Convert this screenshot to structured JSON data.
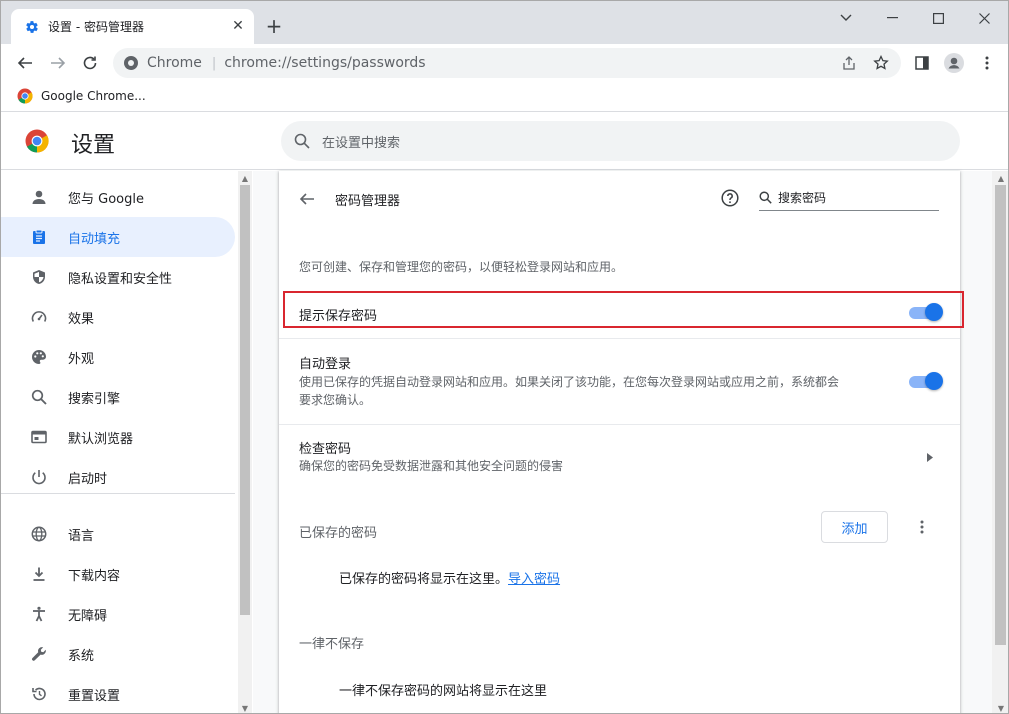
{
  "browser": {
    "tab_title": "设置 - 密码管理器",
    "site_label": "Chrome",
    "url": "chrome://settings/passwords",
    "bookmark_label": "Google Chrome..."
  },
  "settings": {
    "heading": "设置",
    "search_placeholder": "在设置中搜索"
  },
  "sidebar": {
    "items": [
      {
        "label": "您与 Google",
        "icon": "person-icon"
      },
      {
        "label": "自动填充",
        "icon": "autofill-icon",
        "active": true
      },
      {
        "label": "隐私设置和安全性",
        "icon": "shield-icon"
      },
      {
        "label": "效果",
        "icon": "speedometer-icon"
      },
      {
        "label": "外观",
        "icon": "palette-icon"
      },
      {
        "label": "搜索引擎",
        "icon": "search-icon"
      },
      {
        "label": "默认浏览器",
        "icon": "browser-icon"
      },
      {
        "label": "启动时",
        "icon": "power-icon"
      },
      {
        "label": "语言",
        "icon": "globe-icon"
      },
      {
        "label": "下载内容",
        "icon": "download-icon"
      },
      {
        "label": "无障碍",
        "icon": "accessibility-icon"
      },
      {
        "label": "系统",
        "icon": "wrench-icon"
      },
      {
        "label": "重置设置",
        "icon": "reset-icon"
      }
    ]
  },
  "password_manager": {
    "title": "密码管理器",
    "search_placeholder": "搜索密码",
    "description": "您可创建、保存和管理您的密码，以便轻松登录网站和应用。",
    "offer_to_save": {
      "label": "提示保存密码",
      "enabled": true
    },
    "auto_signin": {
      "label": "自动登录",
      "description_line1": "使用已保存的凭据自动登录网站和应用。如果关闭了该功能，在您每次登录网站或应用之前，系统都会",
      "description_line2": "要求您确认。",
      "enabled": true
    },
    "check_passwords": {
      "label": "检查密码",
      "description": "确保您的密码免受数据泄露和其他安全问题的侵害"
    },
    "saved_passwords": {
      "title": "已保存的密码",
      "add_label": "添加",
      "empty_text": "已保存的密码将显示在这里。",
      "import_link": "导入密码"
    },
    "never_saved": {
      "title": "一律不保存",
      "empty_text": "一律不保存密码的网站将显示在这里"
    }
  },
  "colors": {
    "accent": "#1a73e8",
    "highlight_border": "#d9262f",
    "active_nav_bg": "#e8f0fe"
  }
}
